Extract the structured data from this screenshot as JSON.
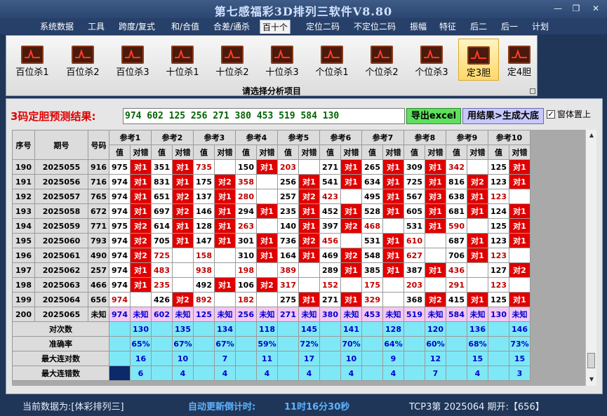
{
  "window": {
    "title": "第七感福彩3D排列三软件V8.80",
    "minimize": "—",
    "restore": "❐",
    "close": "✕"
  },
  "menu": [
    "系统数据",
    "工具",
    "跨度/复式",
    "和/合值",
    "合差/通杀",
    "百十个",
    "定位二码",
    "不定位二码",
    "振幅",
    "特征",
    "后二",
    "后一",
    "计划"
  ],
  "menu_active": "百十个",
  "ribbon": {
    "buttons": [
      "百位杀1",
      "百位杀2",
      "百位杀3",
      "十位杀1",
      "十位杀2",
      "十位杀3",
      "个位杀1",
      "个位杀2",
      "个位杀3",
      "定3胆",
      "定4胆"
    ],
    "selected": "定3胆",
    "caption": "请选择分析项目"
  },
  "result": {
    "label": "3码定胆预测结果:",
    "value": "974 602 125 256 271 380 453 519 584 130",
    "export_label": "导出excel",
    "generate_label": "用结果>生成大底",
    "topmost_label": "窗体置上",
    "topmost_checked": "✓"
  },
  "grid": {
    "headers": {
      "seq": "序号",
      "period": "期号",
      "code": "号码",
      "value": "值",
      "hit": "对错"
    },
    "refs": [
      "参考1",
      "参考2",
      "参考3",
      "参考4",
      "参考5",
      "参考6",
      "参考7",
      "参考8",
      "参考9",
      "参考10"
    ],
    "rows": [
      {
        "seq": "190",
        "period": "2025055",
        "code": "916",
        "cells": [
          [
            "975",
            "对1"
          ],
          [
            "351",
            "对1"
          ],
          [
            "735",
            ""
          ],
          [
            "150",
            "对1"
          ],
          [
            "203",
            ""
          ],
          [
            "271",
            "对1"
          ],
          [
            "265",
            "对1"
          ],
          [
            "309",
            "对1"
          ],
          [
            "342",
            ""
          ],
          [
            "125",
            "对1"
          ]
        ]
      },
      {
        "seq": "191",
        "period": "2025056",
        "code": "716",
        "cells": [
          [
            "974",
            "对1"
          ],
          [
            "831",
            "对1"
          ],
          [
            "175",
            "对2"
          ],
          [
            "358",
            ""
          ],
          [
            "256",
            "对1"
          ],
          [
            "541",
            "对1"
          ],
          [
            "634",
            "对1"
          ],
          [
            "725",
            "对1"
          ],
          [
            "816",
            "对2"
          ],
          [
            "123",
            "对1"
          ]
        ]
      },
      {
        "seq": "192",
        "period": "2025057",
        "code": "765",
        "cells": [
          [
            "974",
            "对1"
          ],
          [
            "651",
            "对2"
          ],
          [
            "137",
            "对1"
          ],
          [
            "280",
            ""
          ],
          [
            "257",
            "对2"
          ],
          [
            "423",
            ""
          ],
          [
            "495",
            "对1"
          ],
          [
            "567",
            "对3"
          ],
          [
            "638",
            "对1"
          ],
          [
            "123",
            ""
          ]
        ]
      },
      {
        "seq": "193",
        "period": "2025058",
        "code": "672",
        "cells": [
          [
            "974",
            "对1"
          ],
          [
            "697",
            "对2"
          ],
          [
            "146",
            "对1"
          ],
          [
            "294",
            "对1"
          ],
          [
            "235",
            "对1"
          ],
          [
            "452",
            "对1"
          ],
          [
            "528",
            "对1"
          ],
          [
            "605",
            "对1"
          ],
          [
            "681",
            "对1"
          ],
          [
            "124",
            "对1"
          ]
        ]
      },
      {
        "seq": "194",
        "period": "2025059",
        "code": "771",
        "cells": [
          [
            "975",
            "对2"
          ],
          [
            "614",
            "对1"
          ],
          [
            "128",
            "对1"
          ],
          [
            "263",
            ""
          ],
          [
            "140",
            "对1"
          ],
          [
            "397",
            "对2"
          ],
          [
            "468",
            ""
          ],
          [
            "531",
            "对1"
          ],
          [
            "590",
            ""
          ],
          [
            "125",
            "对1"
          ]
        ]
      },
      {
        "seq": "195",
        "period": "2025060",
        "code": "793",
        "cells": [
          [
            "974",
            "对2"
          ],
          [
            "705",
            "对1"
          ],
          [
            "147",
            "对1"
          ],
          [
            "301",
            "对1"
          ],
          [
            "736",
            "对2"
          ],
          [
            "456",
            ""
          ],
          [
            "531",
            "对1"
          ],
          [
            "610",
            ""
          ],
          [
            "687",
            "对1"
          ],
          [
            "123",
            "对1"
          ]
        ]
      },
      {
        "seq": "196",
        "period": "2025061",
        "code": "490",
        "cells": [
          [
            "974",
            "对2"
          ],
          [
            "725",
            ""
          ],
          [
            "158",
            ""
          ],
          [
            "310",
            "对1"
          ],
          [
            "164",
            "对1"
          ],
          [
            "469",
            "对2"
          ],
          [
            "548",
            "对1"
          ],
          [
            "627",
            ""
          ],
          [
            "706",
            "对1"
          ],
          [
            "123",
            ""
          ]
        ]
      },
      {
        "seq": "197",
        "period": "2025062",
        "code": "257",
        "cells": [
          [
            "974",
            "对1"
          ],
          [
            "483",
            ""
          ],
          [
            "938",
            ""
          ],
          [
            "198",
            ""
          ],
          [
            "389",
            ""
          ],
          [
            "289",
            "对1"
          ],
          [
            "385",
            "对1"
          ],
          [
            "387",
            "对1"
          ],
          [
            "436",
            ""
          ],
          [
            "127",
            "对2"
          ]
        ]
      },
      {
        "seq": "198",
        "period": "2025063",
        "code": "466",
        "cells": [
          [
            "974",
            "对1"
          ],
          [
            "235",
            ""
          ],
          [
            "492",
            "对1"
          ],
          [
            "106",
            "对2"
          ],
          [
            "317",
            ""
          ],
          [
            "152",
            ""
          ],
          [
            "175",
            ""
          ],
          [
            "203",
            ""
          ],
          [
            "291",
            ""
          ],
          [
            "123",
            ""
          ]
        ]
      },
      {
        "seq": "199",
        "period": "2025064",
        "code": "656",
        "cells": [
          [
            "974",
            ""
          ],
          [
            "426",
            "对2"
          ],
          [
            "892",
            ""
          ],
          [
            "182",
            ""
          ],
          [
            "275",
            "对1"
          ],
          [
            "271",
            "对1"
          ],
          [
            "329",
            ""
          ],
          [
            "368",
            "对2"
          ],
          [
            "415",
            "对1"
          ],
          [
            "125",
            "对1"
          ]
        ]
      },
      {
        "seq": "200",
        "period": "2025065",
        "code": "未知",
        "cells": [
          [
            "974",
            "未知"
          ],
          [
            "602",
            "未知"
          ],
          [
            "125",
            "未知"
          ],
          [
            "256",
            "未知"
          ],
          [
            "271",
            "未知"
          ],
          [
            "380",
            "未知"
          ],
          [
            "453",
            "未知"
          ],
          [
            "519",
            "未知"
          ],
          [
            "584",
            "未知"
          ],
          [
            "130",
            "未知"
          ]
        ]
      }
    ],
    "stats": [
      {
        "label": "对次数",
        "values": [
          "130",
          "135",
          "134",
          "118",
          "145",
          "141",
          "128",
          "120",
          "136",
          "146"
        ]
      },
      {
        "label": "准确率",
        "values": [
          "65%",
          "67%",
          "67%",
          "59%",
          "72%",
          "70%",
          "64%",
          "60%",
          "68%",
          "73%"
        ]
      },
      {
        "label": "最大连对数",
        "values": [
          "16",
          "10",
          "7",
          "11",
          "17",
          "10",
          "9",
          "12",
          "15",
          "15"
        ]
      },
      {
        "label": "最大连错数",
        "values": [
          "6",
          "4",
          "4",
          "4",
          "4",
          "4",
          "4",
          "7",
          "4",
          "3"
        ]
      }
    ]
  },
  "status": {
    "current_data": "当前数据为:[体彩排列三]",
    "countdown_label": "自动更新倒计时:",
    "countdown_value": "11时16分30秒",
    "period_info": "TCP3第 2025064 期开:【656】"
  },
  "colors": {
    "hit": "#e00000",
    "pred": "#f4c7f4",
    "stat": "#7fe8f6",
    "result_text": "#006400",
    "title_text": "#d2e2ff"
  }
}
